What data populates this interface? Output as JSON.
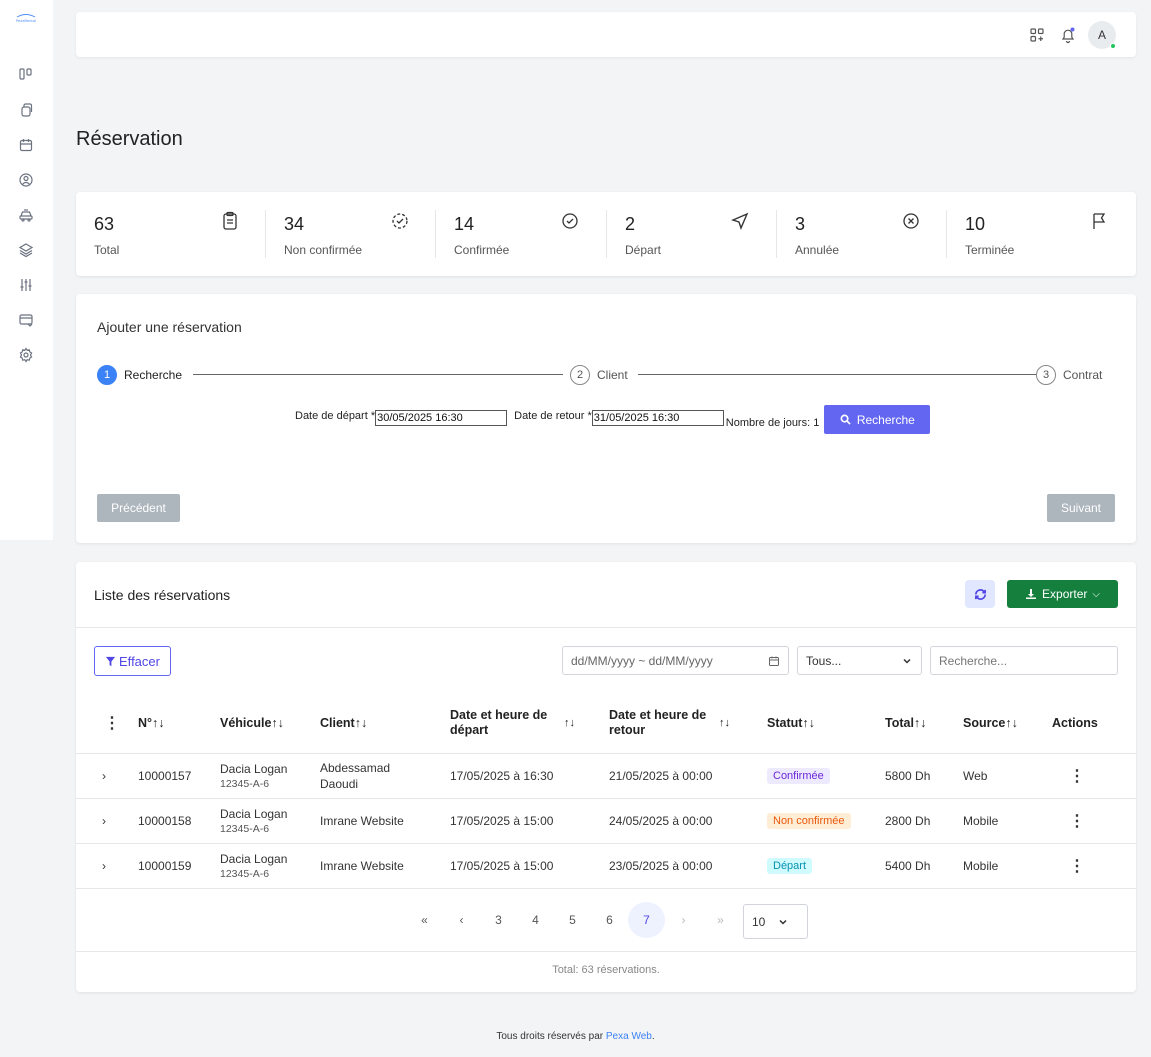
{
  "brand": {
    "logo_text": "PexaRental"
  },
  "topbar": {
    "avatar_letter": "A"
  },
  "page": {
    "title": "Réservation"
  },
  "stats": [
    {
      "value": "63",
      "label": "Total",
      "icon": "clipboard-icon"
    },
    {
      "value": "34",
      "label": "Non confirmée",
      "icon": "pending-check-icon"
    },
    {
      "value": "14",
      "label": "Confirmée",
      "icon": "check-circle-icon"
    },
    {
      "value": "2",
      "label": "Départ",
      "icon": "send-icon"
    },
    {
      "value": "3",
      "label": "Annulée",
      "icon": "cancel-circle-icon"
    },
    {
      "value": "10",
      "label": "Terminée",
      "icon": "flag-icon"
    }
  ],
  "wizard": {
    "title": "Ajouter une réservation",
    "steps": [
      {
        "num": "1",
        "label": "Recherche"
      },
      {
        "num": "2",
        "label": "Client"
      },
      {
        "num": "3",
        "label": "Contrat"
      }
    ],
    "depart_label": "Date de départ *",
    "depart_value": "30/05/2025 16:30",
    "retour_label": "Date de retour *",
    "retour_value": "31/05/2025 16:30",
    "jours_label": "Nombre de jours: 1",
    "search_button": "Recherche",
    "prev_button": "Précédent",
    "next_button": "Suivant"
  },
  "list": {
    "title": "Liste des réservations",
    "export_button": "Exporter",
    "clear_button": "Effacer",
    "date_range_placeholder": "dd/MM/yyyy ~ dd/MM/yyyy",
    "status_select": "Tous...",
    "search_placeholder": "Recherche...",
    "columns": [
      "N°↑↓",
      "Véhicule↑↓",
      "Client↑↓",
      "Date et heure de départ",
      "Date et heure de retour",
      "Statut↑↓",
      "Total↑↓",
      "Source↑↓",
      "Actions"
    ],
    "sort_icon": "↑↓",
    "rows": [
      {
        "num": "10000157",
        "vehicle": "Dacia Logan",
        "plate": "12345-A-6",
        "client": "Abdessamad Daoudi",
        "depart": "17/05/2025 à 16:30",
        "retour": "21/05/2025 à 00:00",
        "status": "Confirmée",
        "status_type": "conf",
        "total": "5800 Dh",
        "source": "Web"
      },
      {
        "num": "10000158",
        "vehicle": "Dacia Logan",
        "plate": "12345-A-6",
        "client": "Imrane Website",
        "depart": "17/05/2025 à 15:00",
        "retour": "24/05/2025 à 00:00",
        "status": "Non confirmée",
        "status_type": "nonc",
        "total": "2800 Dh",
        "source": "Mobile"
      },
      {
        "num": "10000159",
        "vehicle": "Dacia Logan",
        "plate": "12345-A-6",
        "client": "Imrane Website",
        "depart": "17/05/2025 à 15:00",
        "retour": "23/05/2025 à 00:00",
        "status": "Départ",
        "status_type": "dep",
        "total": "5400 Dh",
        "source": "Mobile"
      }
    ],
    "pagination": {
      "first": "«",
      "prev": "‹",
      "pages": [
        "3",
        "4",
        "5",
        "6",
        "7"
      ],
      "current": "7",
      "next": "›",
      "last": "»",
      "page_size": "10"
    },
    "total_text": "Total: 63 réservations."
  },
  "footer": {
    "prefix": "Tous droits réservés par ",
    "link": "Pexa Web",
    "suffix": "."
  }
}
